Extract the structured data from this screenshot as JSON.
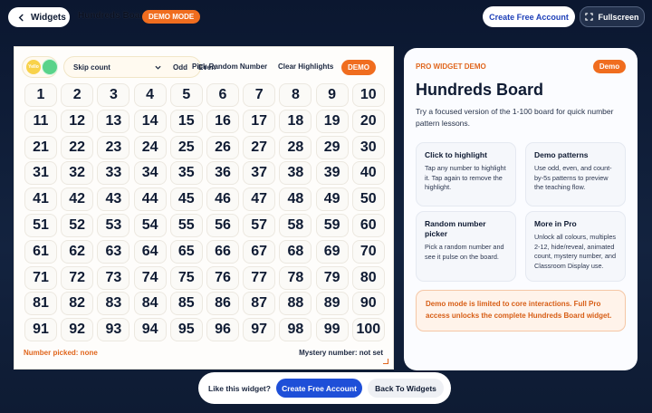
{
  "header": {
    "back_label": "Widgets",
    "title": "Hundreds Board",
    "mode_badge": "DEMO MODE",
    "create_label": "Create Free Account",
    "fullscreen_label": "Fullscreen"
  },
  "toolbar": {
    "swatch_text": "Yello",
    "skip_count_label": "Skip count",
    "odd_label": "Odd",
    "even_label": "Even",
    "pick_random_label": "Pick Random Number",
    "clear_label": "Clear Highlights",
    "demo_badge": "DEMO",
    "colors": {
      "yellow": "#f8d24a",
      "green": "#59d38a",
      "accent": "#f06d1f"
    }
  },
  "board": {
    "numbers": [
      1,
      2,
      3,
      4,
      5,
      6,
      7,
      8,
      9,
      10,
      11,
      12,
      13,
      14,
      15,
      16,
      17,
      18,
      19,
      20,
      21,
      22,
      23,
      24,
      25,
      26,
      27,
      28,
      29,
      30,
      31,
      32,
      33,
      34,
      35,
      36,
      37,
      38,
      39,
      40,
      41,
      42,
      43,
      44,
      45,
      46,
      47,
      48,
      49,
      50,
      51,
      52,
      53,
      54,
      55,
      56,
      57,
      58,
      59,
      60,
      61,
      62,
      63,
      64,
      65,
      66,
      67,
      68,
      69,
      70,
      71,
      72,
      73,
      74,
      75,
      76,
      77,
      78,
      79,
      80,
      81,
      82,
      83,
      84,
      85,
      86,
      87,
      88,
      89,
      90,
      91,
      92,
      93,
      94,
      95,
      96,
      97,
      98,
      99,
      100
    ],
    "number_picked": "Number picked: none",
    "mystery_number": "Mystery number: not set"
  },
  "info": {
    "eyebrow": "PRO WIDGET DEMO",
    "badge": "Demo",
    "title": "Hundreds Board",
    "description": "Try a focused version of the 1-100 board for quick number pattern lessons.",
    "cards": [
      {
        "title": "Click to highlight",
        "body": "Tap any number to highlight it. Tap again to remove the highlight."
      },
      {
        "title": "Demo patterns",
        "body": "Use odd, even, and count-by-5s patterns to preview the teaching flow."
      },
      {
        "title": "Random number picker",
        "body": "Pick a random number and see it pulse on the board."
      },
      {
        "title": "More in Pro",
        "body": "Unlock all colours, multiples 2-12, hide/reveal, animated count, mystery number, and Classroom Display use."
      }
    ],
    "notice": "Demo mode is limited to core interactions. Full Pro access unlocks the complete Hundreds Board widget."
  },
  "footer": {
    "prompt": "Like this widget?",
    "create_label": "Create Free Account",
    "back_label": "Back To Widgets"
  }
}
